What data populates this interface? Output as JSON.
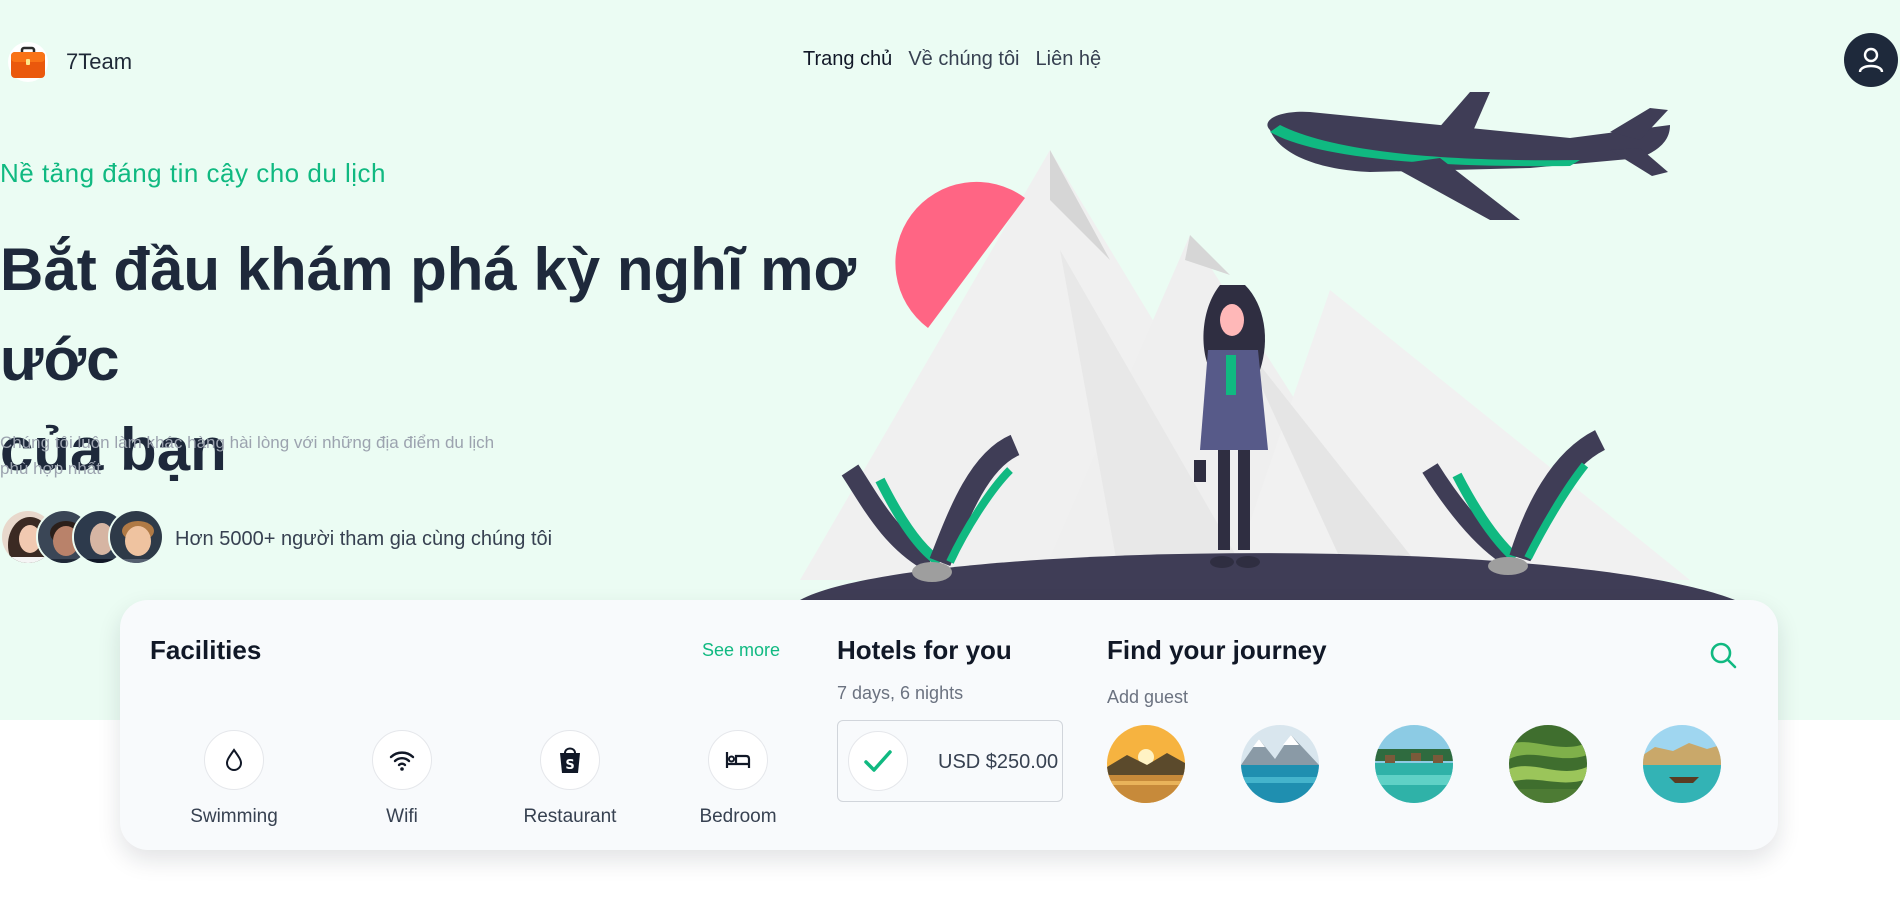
{
  "brand": {
    "name": "7Team",
    "logo_icon": "briefcase-icon"
  },
  "nav": {
    "items": [
      {
        "label": "Trang chủ",
        "active": true
      },
      {
        "label": "Về chúng tôi",
        "active": false
      },
      {
        "label": "Liên hệ",
        "active": false
      }
    ]
  },
  "user": {
    "icon": "user-icon"
  },
  "hero": {
    "eyebrow": "Nề tảng đáng tin cậy cho du lịch",
    "title_line1": "Bắt đầu khám phá kỳ nghĩ mơ ước",
    "title_line2": "của bạn",
    "subtitle": "Chúng tôi luôn làm khác hàng hài lòng với những địa điểm du lịch phù hợp nhất",
    "join_text": "Hơn 5000+ người tham gia cùng chúng tôi",
    "avatar_count": 4
  },
  "facilities": {
    "title": "Facilities",
    "see_more": "See more",
    "items": [
      {
        "label": "Swimming",
        "icon": "water-drop-icon"
      },
      {
        "label": "Wifi",
        "icon": "wifi-icon"
      },
      {
        "label": "Restaurant",
        "icon": "shopping-bag-icon"
      },
      {
        "label": "Bedroom",
        "icon": "bed-icon"
      }
    ]
  },
  "hotels": {
    "title": "Hotels for you",
    "duration": "7 days, 6 nights",
    "price": "USD $250.00"
  },
  "journey": {
    "title": "Find your journey",
    "add_guest": "Add guest",
    "destination_count": 5
  },
  "colors": {
    "accent": "#10b981",
    "hero_bg": "#ebfcf3",
    "dark": "#1e293b",
    "sun": "#ff6584",
    "plane": "#3f3d56"
  }
}
